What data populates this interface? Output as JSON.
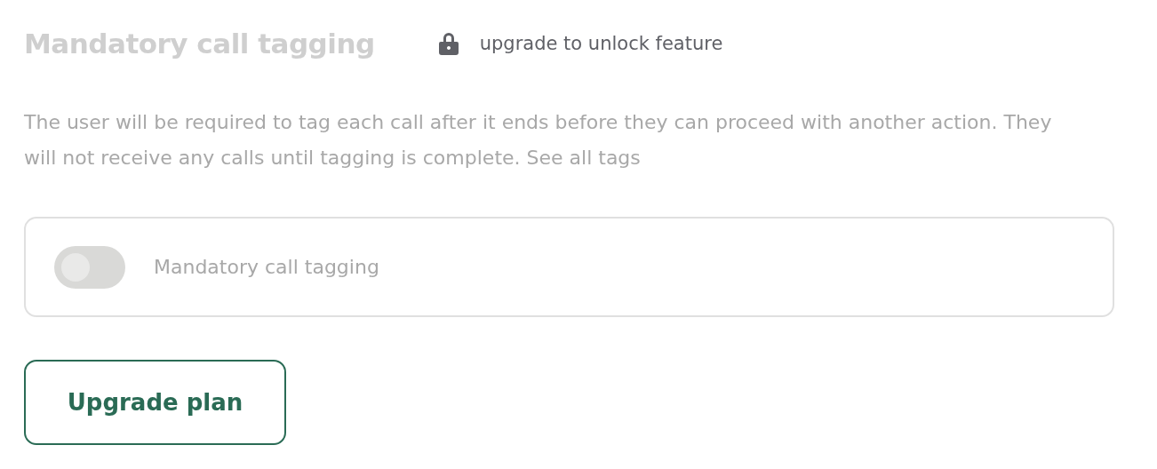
{
  "title": "Mandatory call tagging",
  "disabled": true,
  "lock_notice": {
    "locked": true,
    "label": "upgrade to unlock feature"
  },
  "description": "The user will be required to tag each call after it ends before they can proceed with another action. They will not receive any calls until tagging is complete. See all tags",
  "toggle": {
    "label": "Mandatory call tagging",
    "on": false
  },
  "button": {
    "label": "Upgrade plan"
  }
}
